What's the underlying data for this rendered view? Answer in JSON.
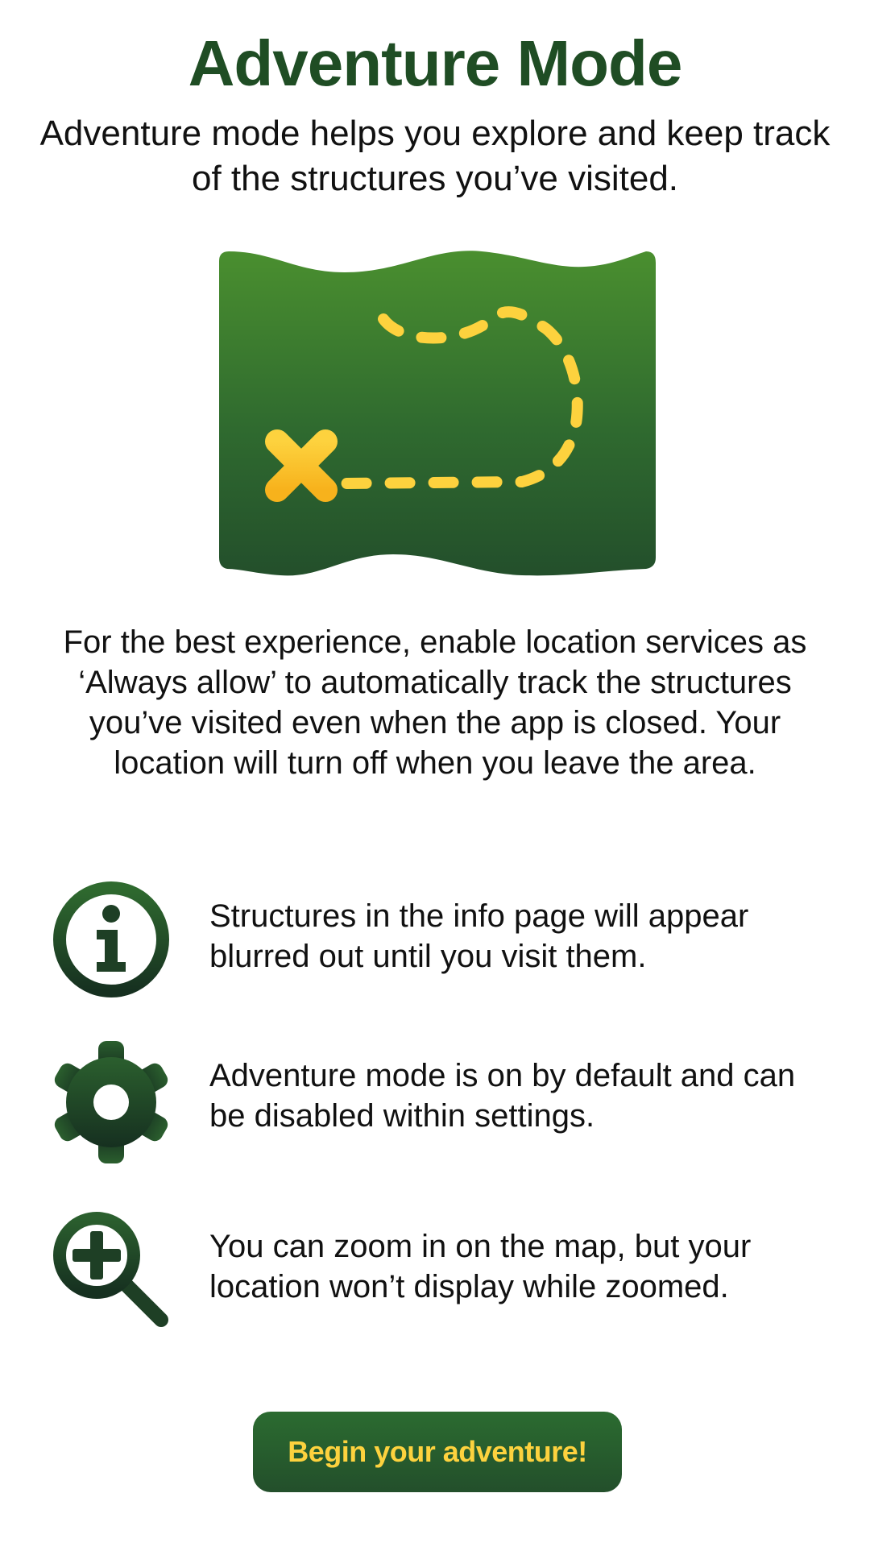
{
  "header": {
    "title": "Adventure Mode",
    "subtitle": "Adventure mode helps you explore and keep track of the structures you’ve visited."
  },
  "illustration": {
    "icon": "treasure-map-icon",
    "colors": {
      "map_top": "#4a8f2f",
      "map_bottom": "#234f2b",
      "trail": "#fdd23e",
      "x_mark_top": "#fdd23e",
      "x_mark_bottom": "#f7b21c"
    }
  },
  "intro": {
    "text": "For the best experience, enable location services as ‘Always allow’ to automatically track the structures you’ve visited even when the app is closed. Your location will turn off when you leave the area."
  },
  "features": [
    {
      "icon": "info-icon",
      "text": "Structures in the info page will appear blurred out until you visit them."
    },
    {
      "icon": "gear-icon",
      "text": "Adventure mode is on by default and can be disabled within settings."
    },
    {
      "icon": "zoom-in-icon",
      "text": "You can zoom in on the map, but your location won’t display while zoomed."
    }
  ],
  "cta": {
    "label": "Begin your adventure!"
  },
  "colors": {
    "brand_green": "#1f4d24",
    "button_text": "#fdd23e",
    "text": "#111111",
    "background": "#ffffff"
  }
}
